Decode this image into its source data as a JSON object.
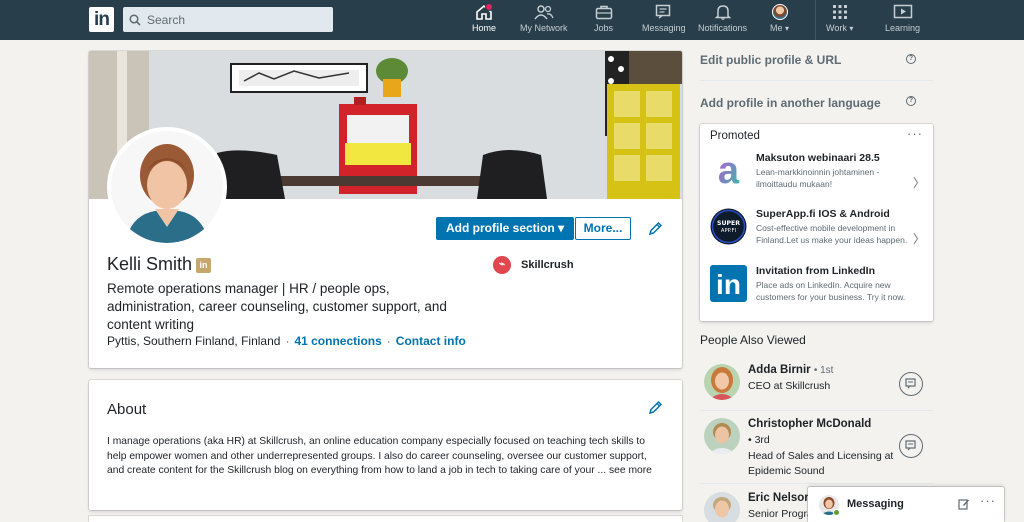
{
  "nav": {
    "search_placeholder": "Search",
    "items": [
      {
        "label": "Home",
        "icon": "home-icon"
      },
      {
        "label": "My Network",
        "icon": "network-icon"
      },
      {
        "label": "Jobs",
        "icon": "briefcase-icon"
      },
      {
        "label": "Messaging",
        "icon": "messaging-icon"
      },
      {
        "label": "Notifications",
        "icon": "bell-icon"
      },
      {
        "label": "Me",
        "icon": "avatar"
      },
      {
        "label": "Work",
        "icon": "grid-icon"
      },
      {
        "label": "Learning",
        "icon": "play-icon"
      }
    ],
    "caret": "▾"
  },
  "profile": {
    "add_section_label": "Add profile section",
    "more_label": "More...",
    "name": "Kelli Smith",
    "badge": "in",
    "headline": "Remote operations manager | HR / people ops, administration, career counseling, customer support, and content writing",
    "location": "Pyttis, Southern Finland, Finland",
    "connections": "41 connections",
    "contact_info": "Contact info",
    "separator": "·",
    "company": "Skillcrush"
  },
  "about": {
    "title": "About",
    "text": "I manage operations (aka HR) at Skillcrush, an online education company especially focused on teaching tech skills to help empower women and other underrepresented groups. I also do career counseling, oversee our customer support, and create content for the Skillcrush blog on everything from how to land a job in tech to taking care of your ...",
    "see_more": "see more"
  },
  "sidebar": {
    "edit_public_profile": "Edit public profile & URL",
    "add_language": "Add profile in another language",
    "help_glyph": "?",
    "promoted": {
      "title": "Promoted",
      "more_glyph": "···",
      "ads": [
        {
          "title": "Maksuton webinaari 28.5",
          "description": "Lean-markkinoinnin johtaminen - ilmoittaudu mukaan!",
          "logo": "a"
        },
        {
          "title": "SuperApp.fi IOS & Android",
          "description": "Cost-effective mobile development in Finland.Let us make your ideas happen.",
          "logo": "SUPER APP.FI"
        },
        {
          "title": "Invitation from LinkedIn",
          "description": "Place ads on LinkedIn. Acquire new customers for your business. Try it now.",
          "logo": "in"
        }
      ]
    },
    "people_also_viewed": {
      "title": "People Also Viewed",
      "people": [
        {
          "name": "Adda Birnir",
          "degree": "• 1st",
          "role": "CEO at Skillcrush"
        },
        {
          "name": "Christopher McDonald",
          "degree": "• 3rd",
          "role": "Head of Sales and Licensing at Epidemic Sound"
        },
        {
          "name": "Eric Nelson",
          "degree": "",
          "role": "Senior Progra"
        }
      ]
    }
  },
  "messaging": {
    "label": "Messaging",
    "more_glyph": "···"
  },
  "colors": {
    "nav_bg": "#283e4a",
    "primary": "#0073b1",
    "page_bg": "#f3f2ef"
  }
}
